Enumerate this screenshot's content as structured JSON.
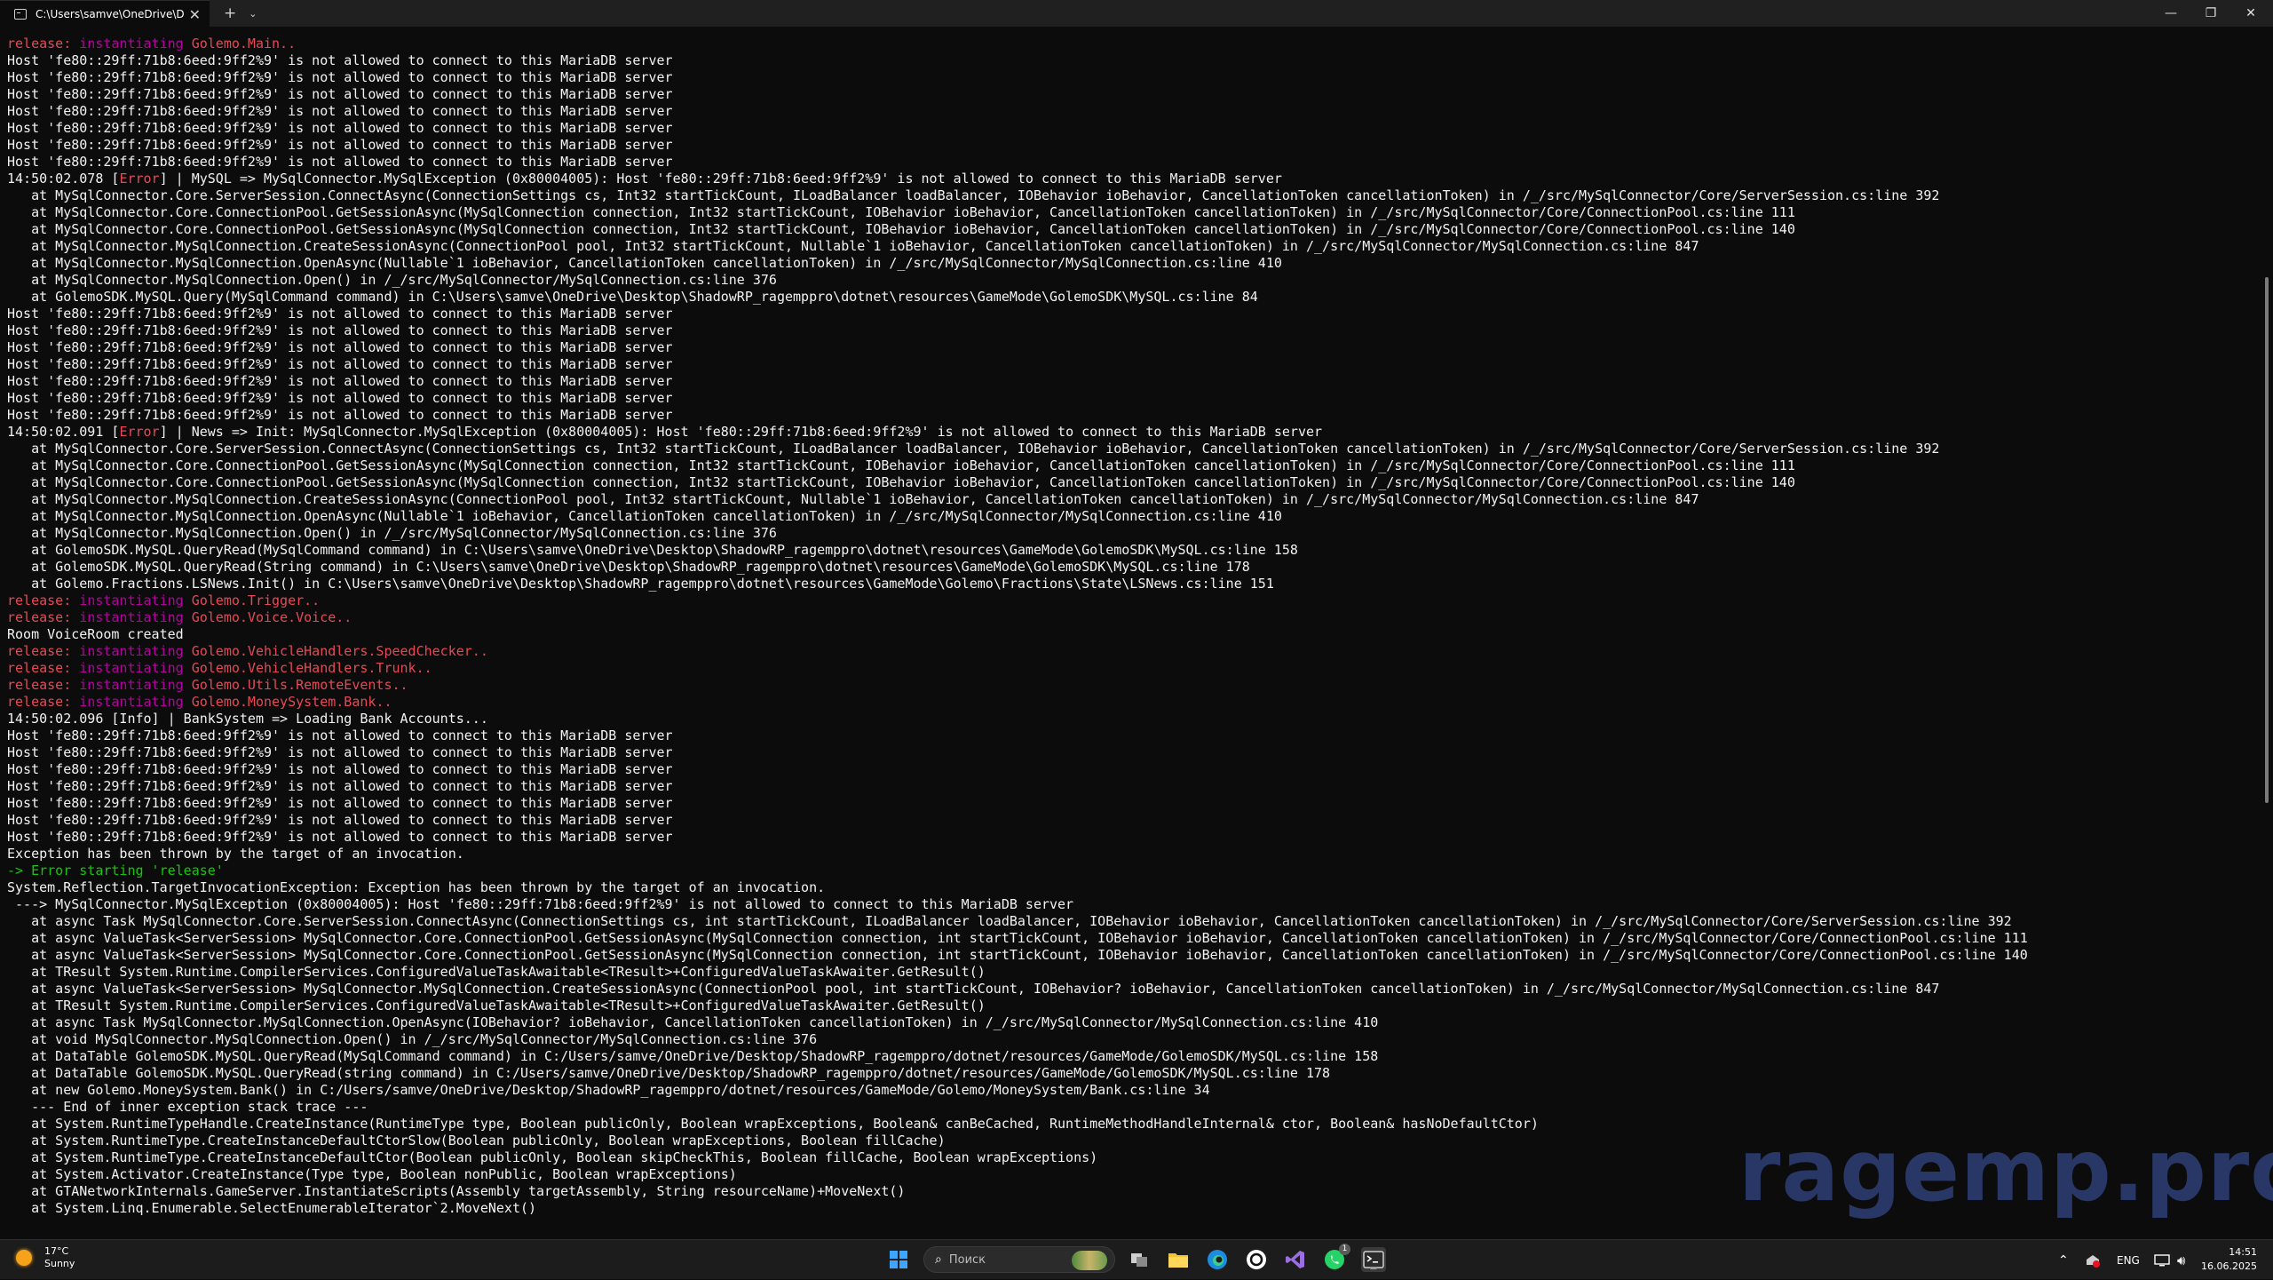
{
  "window": {
    "tab_title": "C:\\Users\\samve\\OneDrive\\Des",
    "tab_close": "✕",
    "new_tab": "+",
    "dropdown": "⌄",
    "minimize": "—",
    "maximize": "❐",
    "close": "✕"
  },
  "colors": {
    "background": "#0c0c0c",
    "text": "#cccccc",
    "release_red": "#e74856",
    "instantiating_magenta": "#b4009e",
    "error_green": "#16c60c"
  },
  "terminal": {
    "lines": [
      [
        {
          "t": "release: ",
          "c": "red"
        },
        {
          "t": "instantiating ",
          "c": "mag"
        },
        {
          "t": "Golemo.Main..",
          "c": "red"
        }
      ],
      [
        {
          "t": "Host 'fe80::29ff:71b8:6eed:9ff2%9' is not allowed to connect to this MariaDB server",
          "c": "white"
        }
      ],
      [
        {
          "t": "Host 'fe80::29ff:71b8:6eed:9ff2%9' is not allowed to connect to this MariaDB server",
          "c": "white"
        }
      ],
      [
        {
          "t": "Host 'fe80::29ff:71b8:6eed:9ff2%9' is not allowed to connect to this MariaDB server",
          "c": "white"
        }
      ],
      [
        {
          "t": "Host 'fe80::29ff:71b8:6eed:9ff2%9' is not allowed to connect to this MariaDB server",
          "c": "white"
        }
      ],
      [
        {
          "t": "Host 'fe80::29ff:71b8:6eed:9ff2%9' is not allowed to connect to this MariaDB server",
          "c": "white"
        }
      ],
      [
        {
          "t": "Host 'fe80::29ff:71b8:6eed:9ff2%9' is not allowed to connect to this MariaDB server",
          "c": "white"
        }
      ],
      [
        {
          "t": "Host 'fe80::29ff:71b8:6eed:9ff2%9' is not allowed to connect to this MariaDB server",
          "c": "white"
        }
      ],
      [
        {
          "t": "14:50:02.078 [",
          "c": "white"
        },
        {
          "t": "Error",
          "c": "red"
        },
        {
          "t": "] | MySQL => MySqlConnector.MySqlException (0x80004005): Host 'fe80::29ff:71b8:6eed:9ff2%9' is not allowed to connect to this MariaDB server",
          "c": "white"
        }
      ],
      [
        {
          "t": "   at MySqlConnector.Core.ServerSession.ConnectAsync(ConnectionSettings cs, Int32 startTickCount, ILoadBalancer loadBalancer, IOBehavior ioBehavior, CancellationToken cancellationToken) in /_/src/MySqlConnector/Core/ServerSession.cs:line 392",
          "c": "white"
        }
      ],
      [
        {
          "t": "   at MySqlConnector.Core.ConnectionPool.GetSessionAsync(MySqlConnection connection, Int32 startTickCount, IOBehavior ioBehavior, CancellationToken cancellationToken) in /_/src/MySqlConnector/Core/ConnectionPool.cs:line 111",
          "c": "white"
        }
      ],
      [
        {
          "t": "   at MySqlConnector.Core.ConnectionPool.GetSessionAsync(MySqlConnection connection, Int32 startTickCount, IOBehavior ioBehavior, CancellationToken cancellationToken) in /_/src/MySqlConnector/Core/ConnectionPool.cs:line 140",
          "c": "white"
        }
      ],
      [
        {
          "t": "   at MySqlConnector.MySqlConnection.CreateSessionAsync(ConnectionPool pool, Int32 startTickCount, Nullable`1 ioBehavior, CancellationToken cancellationToken) in /_/src/MySqlConnector/MySqlConnection.cs:line 847",
          "c": "white"
        }
      ],
      [
        {
          "t": "   at MySqlConnector.MySqlConnection.OpenAsync(Nullable`1 ioBehavior, CancellationToken cancellationToken) in /_/src/MySqlConnector/MySqlConnection.cs:line 410",
          "c": "white"
        }
      ],
      [
        {
          "t": "   at MySqlConnector.MySqlConnection.Open() in /_/src/MySqlConnector/MySqlConnection.cs:line 376",
          "c": "white"
        }
      ],
      [
        {
          "t": "   at GolemoSDK.MySQL.Query(MySqlCommand command) in C:\\Users\\samve\\OneDrive\\Desktop\\ShadowRP_ragemppro\\dotnet\\resources\\GameMode\\GolemoSDK\\MySQL.cs:line 84",
          "c": "white"
        }
      ],
      [
        {
          "t": "Host 'fe80::29ff:71b8:6eed:9ff2%9' is not allowed to connect to this MariaDB server",
          "c": "white"
        }
      ],
      [
        {
          "t": "Host 'fe80::29ff:71b8:6eed:9ff2%9' is not allowed to connect to this MariaDB server",
          "c": "white"
        }
      ],
      [
        {
          "t": "Host 'fe80::29ff:71b8:6eed:9ff2%9' is not allowed to connect to this MariaDB server",
          "c": "white"
        }
      ],
      [
        {
          "t": "Host 'fe80::29ff:71b8:6eed:9ff2%9' is not allowed to connect to this MariaDB server",
          "c": "white"
        }
      ],
      [
        {
          "t": "Host 'fe80::29ff:71b8:6eed:9ff2%9' is not allowed to connect to this MariaDB server",
          "c": "white"
        }
      ],
      [
        {
          "t": "Host 'fe80::29ff:71b8:6eed:9ff2%9' is not allowed to connect to this MariaDB server",
          "c": "white"
        }
      ],
      [
        {
          "t": "Host 'fe80::29ff:71b8:6eed:9ff2%9' is not allowed to connect to this MariaDB server",
          "c": "white"
        }
      ],
      [
        {
          "t": "14:50:02.091 [",
          "c": "white"
        },
        {
          "t": "Error",
          "c": "red"
        },
        {
          "t": "] | News => Init: MySqlConnector.MySqlException (0x80004005): Host 'fe80::29ff:71b8:6eed:9ff2%9' is not allowed to connect to this MariaDB server",
          "c": "white"
        }
      ],
      [
        {
          "t": "   at MySqlConnector.Core.ServerSession.ConnectAsync(ConnectionSettings cs, Int32 startTickCount, ILoadBalancer loadBalancer, IOBehavior ioBehavior, CancellationToken cancellationToken) in /_/src/MySqlConnector/Core/ServerSession.cs:line 392",
          "c": "white"
        }
      ],
      [
        {
          "t": "   at MySqlConnector.Core.ConnectionPool.GetSessionAsync(MySqlConnection connection, Int32 startTickCount, IOBehavior ioBehavior, CancellationToken cancellationToken) in /_/src/MySqlConnector/Core/ConnectionPool.cs:line 111",
          "c": "white"
        }
      ],
      [
        {
          "t": "   at MySqlConnector.Core.ConnectionPool.GetSessionAsync(MySqlConnection connection, Int32 startTickCount, IOBehavior ioBehavior, CancellationToken cancellationToken) in /_/src/MySqlConnector/Core/ConnectionPool.cs:line 140",
          "c": "white"
        }
      ],
      [
        {
          "t": "   at MySqlConnector.MySqlConnection.CreateSessionAsync(ConnectionPool pool, Int32 startTickCount, Nullable`1 ioBehavior, CancellationToken cancellationToken) in /_/src/MySqlConnector/MySqlConnection.cs:line 847",
          "c": "white"
        }
      ],
      [
        {
          "t": "   at MySqlConnector.MySqlConnection.OpenAsync(Nullable`1 ioBehavior, CancellationToken cancellationToken) in /_/src/MySqlConnector/MySqlConnection.cs:line 410",
          "c": "white"
        }
      ],
      [
        {
          "t": "   at MySqlConnector.MySqlConnection.Open() in /_/src/MySqlConnector/MySqlConnection.cs:line 376",
          "c": "white"
        }
      ],
      [
        {
          "t": "   at GolemoSDK.MySQL.QueryRead(MySqlCommand command) in C:\\Users\\samve\\OneDrive\\Desktop\\ShadowRP_ragemppro\\dotnet\\resources\\GameMode\\GolemoSDK\\MySQL.cs:line 158",
          "c": "white"
        }
      ],
      [
        {
          "t": "   at GolemoSDK.MySQL.QueryRead(String command) in C:\\Users\\samve\\OneDrive\\Desktop\\ShadowRP_ragemppro\\dotnet\\resources\\GameMode\\GolemoSDK\\MySQL.cs:line 178",
          "c": "white"
        }
      ],
      [
        {
          "t": "   at Golemo.Fractions.LSNews.Init() in C:\\Users\\samve\\OneDrive\\Desktop\\ShadowRP_ragemppro\\dotnet\\resources\\GameMode\\Golemo\\Fractions\\State\\LSNews.cs:line 151",
          "c": "white"
        }
      ],
      [
        {
          "t": "release: ",
          "c": "red"
        },
        {
          "t": "instantiating ",
          "c": "mag"
        },
        {
          "t": "Golemo.Trigger..",
          "c": "red"
        }
      ],
      [
        {
          "t": "release: ",
          "c": "red"
        },
        {
          "t": "instantiating ",
          "c": "mag"
        },
        {
          "t": "Golemo.Voice.Voice..",
          "c": "red"
        }
      ],
      [
        {
          "t": "Room VoiceRoom created",
          "c": "white"
        }
      ],
      [
        {
          "t": "release: ",
          "c": "red"
        },
        {
          "t": "instantiating ",
          "c": "mag"
        },
        {
          "t": "Golemo.VehicleHandlers.SpeedChecker..",
          "c": "red"
        }
      ],
      [
        {
          "t": "release: ",
          "c": "red"
        },
        {
          "t": "instantiating ",
          "c": "mag"
        },
        {
          "t": "Golemo.VehicleHandlers.Trunk..",
          "c": "red"
        }
      ],
      [
        {
          "t": "release: ",
          "c": "red"
        },
        {
          "t": "instantiating ",
          "c": "mag"
        },
        {
          "t": "Golemo.Utils.RemoteEvents..",
          "c": "red"
        }
      ],
      [
        {
          "t": "release: ",
          "c": "red"
        },
        {
          "t": "instantiating ",
          "c": "mag"
        },
        {
          "t": "Golemo.MoneySystem.Bank..",
          "c": "red"
        }
      ],
      [
        {
          "t": "14:50:02.096 [Info] | BankSystem => Loading Bank Accounts...",
          "c": "white"
        }
      ],
      [
        {
          "t": "Host 'fe80::29ff:71b8:6eed:9ff2%9' is not allowed to connect to this MariaDB server",
          "c": "white"
        }
      ],
      [
        {
          "t": "Host 'fe80::29ff:71b8:6eed:9ff2%9' is not allowed to connect to this MariaDB server",
          "c": "white"
        }
      ],
      [
        {
          "t": "Host 'fe80::29ff:71b8:6eed:9ff2%9' is not allowed to connect to this MariaDB server",
          "c": "white"
        }
      ],
      [
        {
          "t": "Host 'fe80::29ff:71b8:6eed:9ff2%9' is not allowed to connect to this MariaDB server",
          "c": "white"
        }
      ],
      [
        {
          "t": "Host 'fe80::29ff:71b8:6eed:9ff2%9' is not allowed to connect to this MariaDB server",
          "c": "white"
        }
      ],
      [
        {
          "t": "Host 'fe80::29ff:71b8:6eed:9ff2%9' is not allowed to connect to this MariaDB server",
          "c": "white"
        }
      ],
      [
        {
          "t": "Host 'fe80::29ff:71b8:6eed:9ff2%9' is not allowed to connect to this MariaDB server",
          "c": "white"
        }
      ],
      [
        {
          "t": "Exception has been thrown by the target of an invocation.",
          "c": "white"
        }
      ],
      [
        {
          "t": "-> Error starting 'release'",
          "c": "green"
        }
      ],
      [
        {
          "t": "System.Reflection.TargetInvocationException: Exception has been thrown by the target of an invocation.",
          "c": "white"
        }
      ],
      [
        {
          "t": " ---> MySqlConnector.MySqlException (0x80004005): Host 'fe80::29ff:71b8:6eed:9ff2%9' is not allowed to connect to this MariaDB server",
          "c": "white"
        }
      ],
      [
        {
          "t": "   at async Task MySqlConnector.Core.ServerSession.ConnectAsync(ConnectionSettings cs, int startTickCount, ILoadBalancer loadBalancer, IOBehavior ioBehavior, CancellationToken cancellationToken) in /_/src/MySqlConnector/Core/ServerSession.cs:line 392",
          "c": "white"
        }
      ],
      [
        {
          "t": "   at async ValueTask<ServerSession> MySqlConnector.Core.ConnectionPool.GetSessionAsync(MySqlConnection connection, int startTickCount, IOBehavior ioBehavior, CancellationToken cancellationToken) in /_/src/MySqlConnector/Core/ConnectionPool.cs:line 111",
          "c": "white"
        }
      ],
      [
        {
          "t": "   at async ValueTask<ServerSession> MySqlConnector.Core.ConnectionPool.GetSessionAsync(MySqlConnection connection, int startTickCount, IOBehavior ioBehavior, CancellationToken cancellationToken) in /_/src/MySqlConnector/Core/ConnectionPool.cs:line 140",
          "c": "white"
        }
      ],
      [
        {
          "t": "   at TResult System.Runtime.CompilerServices.ConfiguredValueTaskAwaitable<TResult>+ConfiguredValueTaskAwaiter.GetResult()",
          "c": "white"
        }
      ],
      [
        {
          "t": "   at async ValueTask<ServerSession> MySqlConnector.MySqlConnection.CreateSessionAsync(ConnectionPool pool, int startTickCount, IOBehavior? ioBehavior, CancellationToken cancellationToken) in /_/src/MySqlConnector/MySqlConnection.cs:line 847",
          "c": "white"
        }
      ],
      [
        {
          "t": "   at TResult System.Runtime.CompilerServices.ConfiguredValueTaskAwaitable<TResult>+ConfiguredValueTaskAwaiter.GetResult()",
          "c": "white"
        }
      ],
      [
        {
          "t": "   at async Task MySqlConnector.MySqlConnection.OpenAsync(IOBehavior? ioBehavior, CancellationToken cancellationToken) in /_/src/MySqlConnector/MySqlConnection.cs:line 410",
          "c": "white"
        }
      ],
      [
        {
          "t": "   at void MySqlConnector.MySqlConnection.Open() in /_/src/MySqlConnector/MySqlConnection.cs:line 376",
          "c": "white"
        }
      ],
      [
        {
          "t": "   at DataTable GolemoSDK.MySQL.QueryRead(MySqlCommand command) in C:/Users/samve/OneDrive/Desktop/ShadowRP_ragemppro/dotnet/resources/GameMode/GolemoSDK/MySQL.cs:line 158",
          "c": "white"
        }
      ],
      [
        {
          "t": "   at DataTable GolemoSDK.MySQL.QueryRead(string command) in C:/Users/samve/OneDrive/Desktop/ShadowRP_ragemppro/dotnet/resources/GameMode/GolemoSDK/MySQL.cs:line 178",
          "c": "white"
        }
      ],
      [
        {
          "t": "   at new Golemo.MoneySystem.Bank() in C:/Users/samve/OneDrive/Desktop/ShadowRP_ragemppro/dotnet/resources/GameMode/Golemo/MoneySystem/Bank.cs:line 34",
          "c": "white"
        }
      ],
      [
        {
          "t": "   --- End of inner exception stack trace ---",
          "c": "white"
        }
      ],
      [
        {
          "t": "   at System.RuntimeTypeHandle.CreateInstance(RuntimeType type, Boolean publicOnly, Boolean wrapExceptions, Boolean& canBeCached, RuntimeMethodHandleInternal& ctor, Boolean& hasNoDefaultCtor)",
          "c": "white"
        }
      ],
      [
        {
          "t": "   at System.RuntimeType.CreateInstanceDefaultCtorSlow(Boolean publicOnly, Boolean wrapExceptions, Boolean fillCache)",
          "c": "white"
        }
      ],
      [
        {
          "t": "   at System.RuntimeType.CreateInstanceDefaultCtor(Boolean publicOnly, Boolean skipCheckThis, Boolean fillCache, Boolean wrapExceptions)",
          "c": "white"
        }
      ],
      [
        {
          "t": "   at System.Activator.CreateInstance(Type type, Boolean nonPublic, Boolean wrapExceptions)",
          "c": "white"
        }
      ],
      [
        {
          "t": "   at GTANetworkInternals.GameServer.InstantiateScripts(Assembly targetAssembly, String resourceName)+MoveNext()",
          "c": "white"
        }
      ],
      [
        {
          "t": "   at System.Linq.Enumerable.SelectEnumerableIterator`2.MoveNext()",
          "c": "white"
        }
      ]
    ]
  },
  "watermark": "ragemp.pro",
  "taskbar": {
    "weather_temp": "17°C",
    "weather_desc": "Sunny",
    "search_placeholder": "Поиск",
    "language": "ENG",
    "time": "14:51",
    "date": "16.06.2025",
    "whatsapp_badge": "1",
    "apps": [
      "start-icon",
      "search-box",
      "task-view-icon",
      "file-explorer-icon",
      "edge-icon",
      "chatgpt-icon",
      "visual-studio-icon",
      "whatsapp-icon",
      "terminal-icon"
    ]
  }
}
